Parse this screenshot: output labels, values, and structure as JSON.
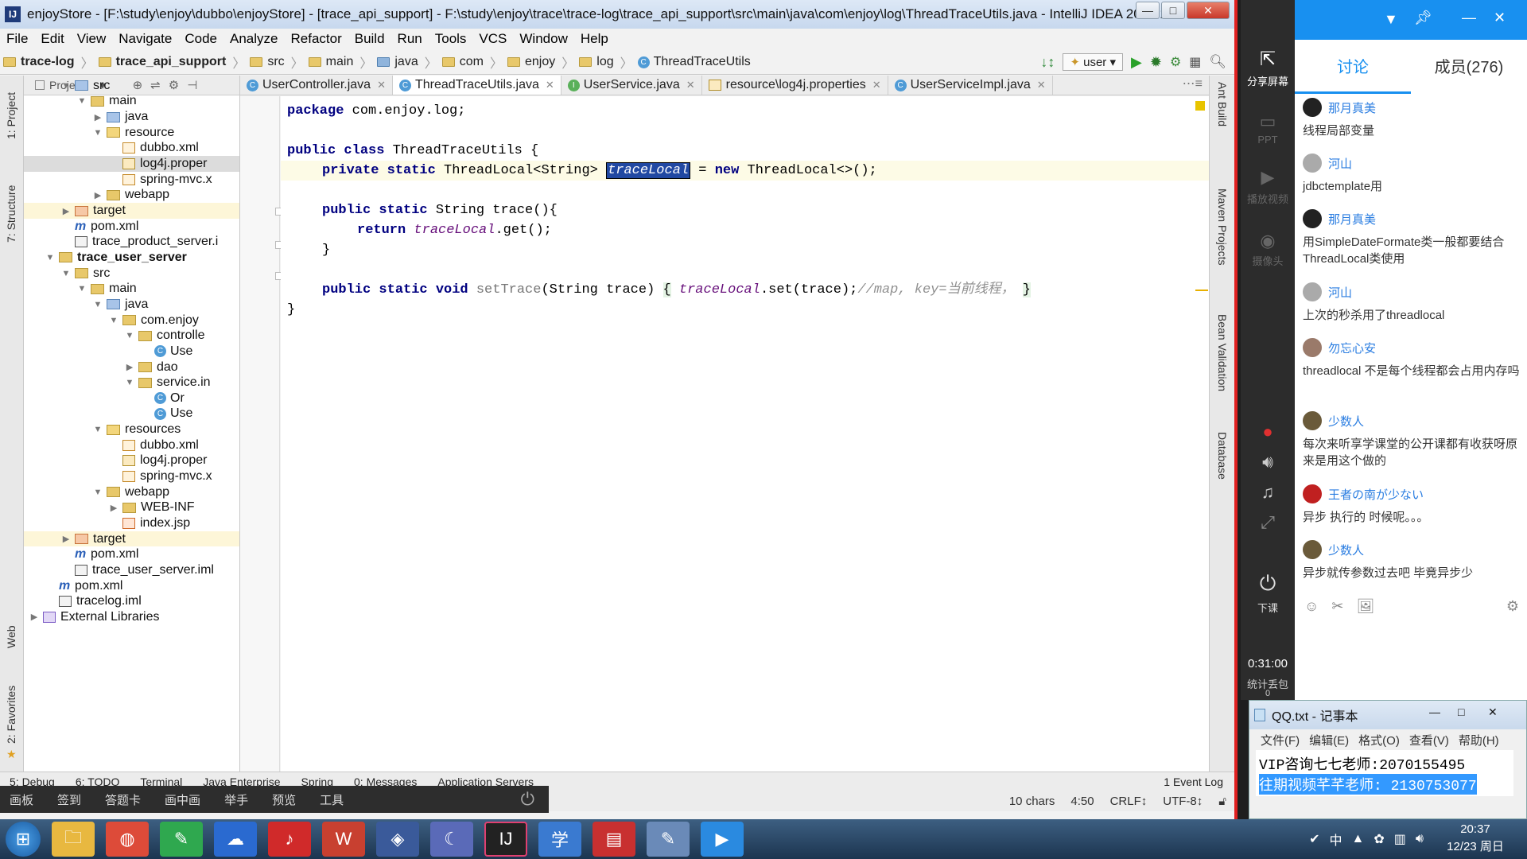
{
  "window": {
    "title": "enjoyStore - [F:\\study\\enjoy\\dubbo\\enjoyStore] - [trace_api_support] - F:\\study\\enjoy\\trace\\trace-log\\trace_api_support\\src\\main\\java\\com\\enjoy\\log\\ThreadTraceUtils.java - IntelliJ IDEA 2016.1.1",
    "min_icon": "minimize-icon",
    "max_icon": "maximize-icon",
    "close_icon": "close-icon"
  },
  "menu": [
    "File",
    "Edit",
    "View",
    "Navigate",
    "Code",
    "Analyze",
    "Refactor",
    "Build",
    "Run",
    "Tools",
    "VCS",
    "Window",
    "Help"
  ],
  "breadcrumb": [
    "trace-log",
    "trace_api_support",
    "src",
    "main",
    "java",
    "com",
    "enjoy",
    "log",
    "ThreadTraceUtils"
  ],
  "toolbar": {
    "run_config": "user"
  },
  "project_panel": {
    "header": "Project",
    "items": [
      {
        "label": "src",
        "depth": 2,
        "type": "src",
        "state": "open"
      },
      {
        "label": "main",
        "depth": 3,
        "type": "folder",
        "state": "open"
      },
      {
        "label": "java",
        "depth": 4,
        "type": "src",
        "state": "closed"
      },
      {
        "label": "resource",
        "depth": 4,
        "type": "res",
        "state": "open"
      },
      {
        "label": "dubbo.xml",
        "depth": 5,
        "type": "xml",
        "state": ""
      },
      {
        "label": "log4j.proper",
        "depth": 5,
        "type": "prop",
        "state": "",
        "selected": true
      },
      {
        "label": "spring-mvc.x",
        "depth": 5,
        "type": "xml",
        "state": ""
      },
      {
        "label": "webapp",
        "depth": 4,
        "type": "folder",
        "state": "closed"
      },
      {
        "label": "target",
        "depth": 2,
        "type": "tgt",
        "state": "closed",
        "hl": true
      },
      {
        "label": "pom.xml",
        "depth": 2,
        "type": "m",
        "state": ""
      },
      {
        "label": "trace_product_server.i",
        "depth": 2,
        "type": "iml",
        "state": ""
      },
      {
        "label": "trace_user_server",
        "depth": 1,
        "type": "folder",
        "state": "open",
        "bold": true
      },
      {
        "label": "src",
        "depth": 2,
        "type": "folder",
        "state": "open"
      },
      {
        "label": "main",
        "depth": 3,
        "type": "folder",
        "state": "open"
      },
      {
        "label": "java",
        "depth": 4,
        "type": "src",
        "state": "open"
      },
      {
        "label": "com.enjoy",
        "depth": 5,
        "type": "folder",
        "state": "open"
      },
      {
        "label": "controlle",
        "depth": 6,
        "type": "folder",
        "state": "open"
      },
      {
        "label": "Use",
        "depth": 7,
        "type": "class",
        "state": ""
      },
      {
        "label": "dao",
        "depth": 6,
        "type": "folder",
        "state": "closed"
      },
      {
        "label": "service.in",
        "depth": 6,
        "type": "folder",
        "state": "open"
      },
      {
        "label": "Or",
        "depth": 7,
        "type": "class",
        "state": ""
      },
      {
        "label": "Use",
        "depth": 7,
        "type": "class",
        "state": ""
      },
      {
        "label": "resources",
        "depth": 4,
        "type": "res",
        "state": "open"
      },
      {
        "label": "dubbo.xml",
        "depth": 5,
        "type": "xml",
        "state": ""
      },
      {
        "label": "log4j.proper",
        "depth": 5,
        "type": "prop",
        "state": ""
      },
      {
        "label": "spring-mvc.x",
        "depth": 5,
        "type": "xml",
        "state": ""
      },
      {
        "label": "webapp",
        "depth": 4,
        "type": "folder",
        "state": "open"
      },
      {
        "label": "WEB-INF",
        "depth": 5,
        "type": "folder",
        "state": "closed"
      },
      {
        "label": "index.jsp",
        "depth": 5,
        "type": "jsp",
        "state": ""
      },
      {
        "label": "target",
        "depth": 2,
        "type": "tgt",
        "state": "closed",
        "hl": true
      },
      {
        "label": "pom.xml",
        "depth": 2,
        "type": "m",
        "state": ""
      },
      {
        "label": "trace_user_server.iml",
        "depth": 2,
        "type": "iml",
        "state": ""
      },
      {
        "label": "pom.xml",
        "depth": 1,
        "type": "m",
        "state": ""
      },
      {
        "label": "tracelog.iml",
        "depth": 1,
        "type": "iml",
        "state": ""
      },
      {
        "label": "External Libraries",
        "depth": 0,
        "type": "lib",
        "state": "closed"
      }
    ]
  },
  "left_tool_windows": [
    "1: Project",
    "7: Structure",
    "Web",
    "2: Favorites"
  ],
  "right_tool_windows": [
    "Ant Build",
    "Maven Projects",
    "Bean Validation",
    "Database"
  ],
  "editor_tabs": [
    {
      "label": "UserController.java",
      "icon": "class"
    },
    {
      "label": "ThreadTraceUtils.java",
      "icon": "class",
      "active": true
    },
    {
      "label": "UserService.java",
      "icon": "interface"
    },
    {
      "label": "resource\\log4j.properties",
      "icon": "properties"
    },
    {
      "label": "UserServiceImpl.java",
      "icon": "class"
    }
  ],
  "code": {
    "line1": {
      "kw": "package",
      "rest": " com.enjoy.log;"
    },
    "line3": {
      "kw": "public class",
      "rest": " ThreadTraceUtils {"
    },
    "line4": {
      "kw": "private static",
      "mid": " ThreadLocal<String> ",
      "sel": "traceLocal",
      "eq": " = ",
      "kw2": "new",
      "tail": " ThreadLocal<>();"
    },
    "line6": {
      "kw": "public static",
      "rest": " String trace(){"
    },
    "line7": {
      "kw": "return",
      "fld": "traceLocal",
      "rest": ".get();"
    },
    "line8": {
      "rest": "}"
    },
    "line10": {
      "kw": "public static void",
      "mth": "setTrace",
      "args": "(String trace)",
      "open": "{",
      "fld": "traceLocal",
      "call": ".set(trace);",
      "cm": "//map, key=当前线程，",
      "close": "}"
    },
    "line11": {
      "rest": "}"
    }
  },
  "bottom_tools": [
    "5: Debug",
    "6: TODO",
    "Terminal",
    "Java Enterprise",
    "Spring",
    "0: Messages",
    "Application Servers",
    "1 Event Log"
  ],
  "status": {
    "chars": "10 chars",
    "pos": "4:50",
    "eol": "CRLF↕",
    "enc": "UTF-8↕"
  },
  "overlay_bar": [
    "画板",
    "签到",
    "答题卡",
    "画中画",
    "举手",
    "预览",
    "工具"
  ],
  "dark_strip": {
    "share": "分享屏幕",
    "ppt": "PPT",
    "video": "播放视频",
    "camera": "摄像头",
    "class_end": "下课",
    "timer": "0:31:00",
    "lost": "统计丢包",
    "lost_count": "0"
  },
  "chat": {
    "tab_discuss": "讨论",
    "tab_members": "成员(276)",
    "messages": [
      {
        "name": "那月真美",
        "text": "线程局部变量"
      },
      {
        "name": "河山",
        "text": "jdbctemplate用"
      },
      {
        "name": "那月真美",
        "text": "用SimpleDateFormate类一般都要结合ThreadLocal类使用"
      },
      {
        "name": "河山",
        "text": "上次的秒杀用了threadlocal"
      },
      {
        "name": "勿忘心安",
        "text": "threadlocal 不是每个线程都会占用内存吗"
      },
      {
        "name": "少数人",
        "text": "每次来听享学课堂的公开课都有收获呀原来是用这个做的"
      },
      {
        "name": "王者の南が少ない",
        "text": "异步 执行的 时候呢。。。"
      },
      {
        "name": "少数人",
        "text": "异步就传参数过去吧 毕竟异步少"
      }
    ]
  },
  "notepad": {
    "title": "QQ.txt - 记事本",
    "menu": [
      "文件(F)",
      "编辑(E)",
      "格式(O)",
      "查看(V)",
      "帮助(H)"
    ],
    "line1": "VIP咨询七七老师:2070155495",
    "line2": "往期视频芊芊老师: 2130753077"
  },
  "taskbar": {
    "time": "20:37",
    "date": "12/23 周日",
    "tray_ime": "中"
  }
}
